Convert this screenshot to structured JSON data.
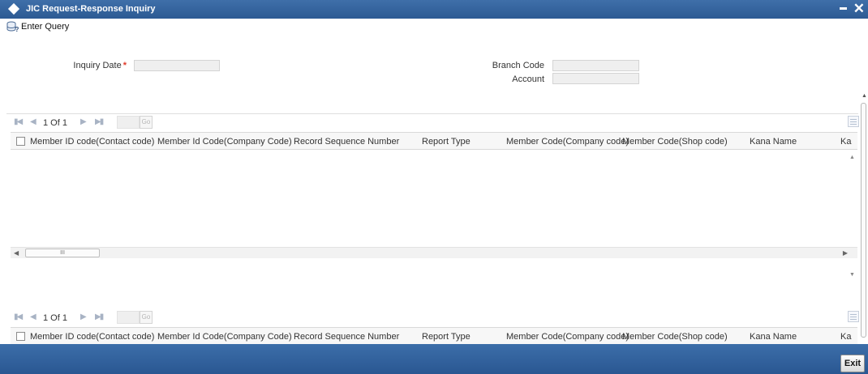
{
  "window": {
    "title": "JIC Request-Response Inquiry",
    "minimize_glyph": "–",
    "close_glyph": "✕",
    "title_icon": "diamond-icon"
  },
  "toolbar": {
    "enter_query_label": "Enter Query",
    "enter_query_icon": "query-db-icon"
  },
  "form": {
    "inquiry_date": {
      "label": "Inquiry Date",
      "required_mark": "*",
      "value": ""
    },
    "branch_code": {
      "label": "Branch Code",
      "value": ""
    },
    "account": {
      "label": "Account",
      "value": ""
    }
  },
  "grids": [
    {
      "pager": {
        "first": "▮◀",
        "prev": "◀",
        "page_text": "1 Of 1",
        "next": "▶",
        "last": "▶▮",
        "page_input": "",
        "go_label": "Go"
      },
      "columns": [
        "Member ID code(Contact code)",
        "Member Id Code(Company Code)",
        "Record Sequence Number",
        "Report Type",
        "Member Code(Company code)",
        "Member Code(Shop code)",
        "Kana Name",
        "Ka"
      ],
      "rows": [],
      "hscroll_thumb_glyph": "III"
    },
    {
      "pager": {
        "first": "▮◀",
        "prev": "◀",
        "page_text": "1 Of 1",
        "next": "▶",
        "last": "▶▮",
        "page_input": "",
        "go_label": "Go"
      },
      "columns": [
        "Member ID code(Contact code)",
        "Member Id Code(Company Code)",
        "Record Sequence Number",
        "Report Type",
        "Member Code(Company code)",
        "Member Code(Shop code)",
        "Kana Name",
        "Ka"
      ],
      "rows": []
    }
  ],
  "footer": {
    "exit_label": "Exit"
  },
  "colors": {
    "titlebar": "#2c5a93",
    "footer": "#2a5792",
    "required": "#e03a2a"
  }
}
